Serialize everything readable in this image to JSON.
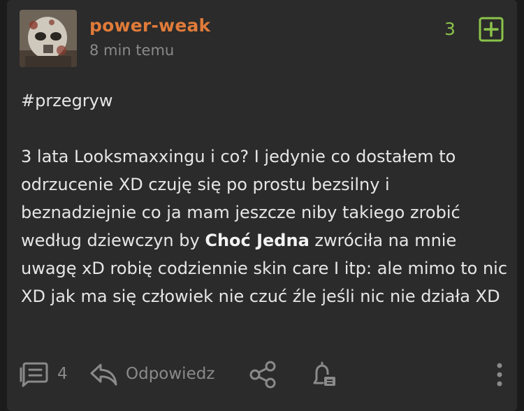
{
  "post": {
    "author": "power-weak",
    "time": "8 min temu",
    "votes": "3",
    "tag": "#przegryw",
    "text_before_bold": "3 lata Looksmaxxingu i co? I jedynie co dostałem to odrzucenie XD czuję się po prostu bezsilny i beznadziejnie co ja mam jeszcze niby takiego zrobić według dziewczyn by ",
    "text_bold": "Choć Jedna",
    "text_after_bold": " zwróciła na mnie uwagę xD robię codziennie skin care I itp: ale mimo to nic XD jak ma się człowiek nie czuć źle jeśli nic nie działa XD"
  },
  "footer": {
    "comments_count": "4",
    "reply_label": "Odpowiedz"
  },
  "icons": {
    "plus": "plus-square-icon",
    "comments": "comments-icon",
    "reply": "reply-arrow-icon",
    "share": "share-icon",
    "notify": "bell-icon",
    "more": "more-vertical-icon"
  },
  "colors": {
    "author": "#e07b39",
    "votes": "#8bc34a",
    "text": "#e6e6e6",
    "muted": "#8a8a8a",
    "card_bg": "#2b2b2b"
  }
}
